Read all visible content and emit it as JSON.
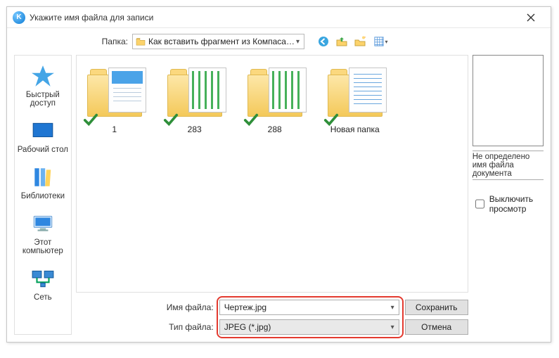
{
  "window": {
    "title": "Укажите имя файла для записи"
  },
  "toolbar": {
    "folder_label": "Папка:",
    "current_folder": "Как вставить фрагмент из Компаса в Вор"
  },
  "places": [
    {
      "key": "quick",
      "label": "Быстрый доступ"
    },
    {
      "key": "desktop",
      "label": "Рабочий стол"
    },
    {
      "key": "libs",
      "label": "Библиотеки"
    },
    {
      "key": "computer",
      "label": "Этот компьютер"
    },
    {
      "key": "network",
      "label": "Сеть"
    }
  ],
  "items": [
    {
      "label": "1",
      "doc": "blue"
    },
    {
      "label": "283",
      "doc": "green"
    },
    {
      "label": "288",
      "doc": "green"
    },
    {
      "label": "Новая папка",
      "doc": "blue2"
    }
  ],
  "preview": {
    "status_text": "Не определено имя файла документа",
    "toggle_label": "Выключить просмотр"
  },
  "bottom": {
    "filename_label": "Имя файла:",
    "filetype_label": "Тип файла:",
    "filename_value": "Чертеж.jpg",
    "filetype_value": "JPEG (*.jpg)",
    "save_label": "Сохранить",
    "cancel_label": "Отмена"
  }
}
